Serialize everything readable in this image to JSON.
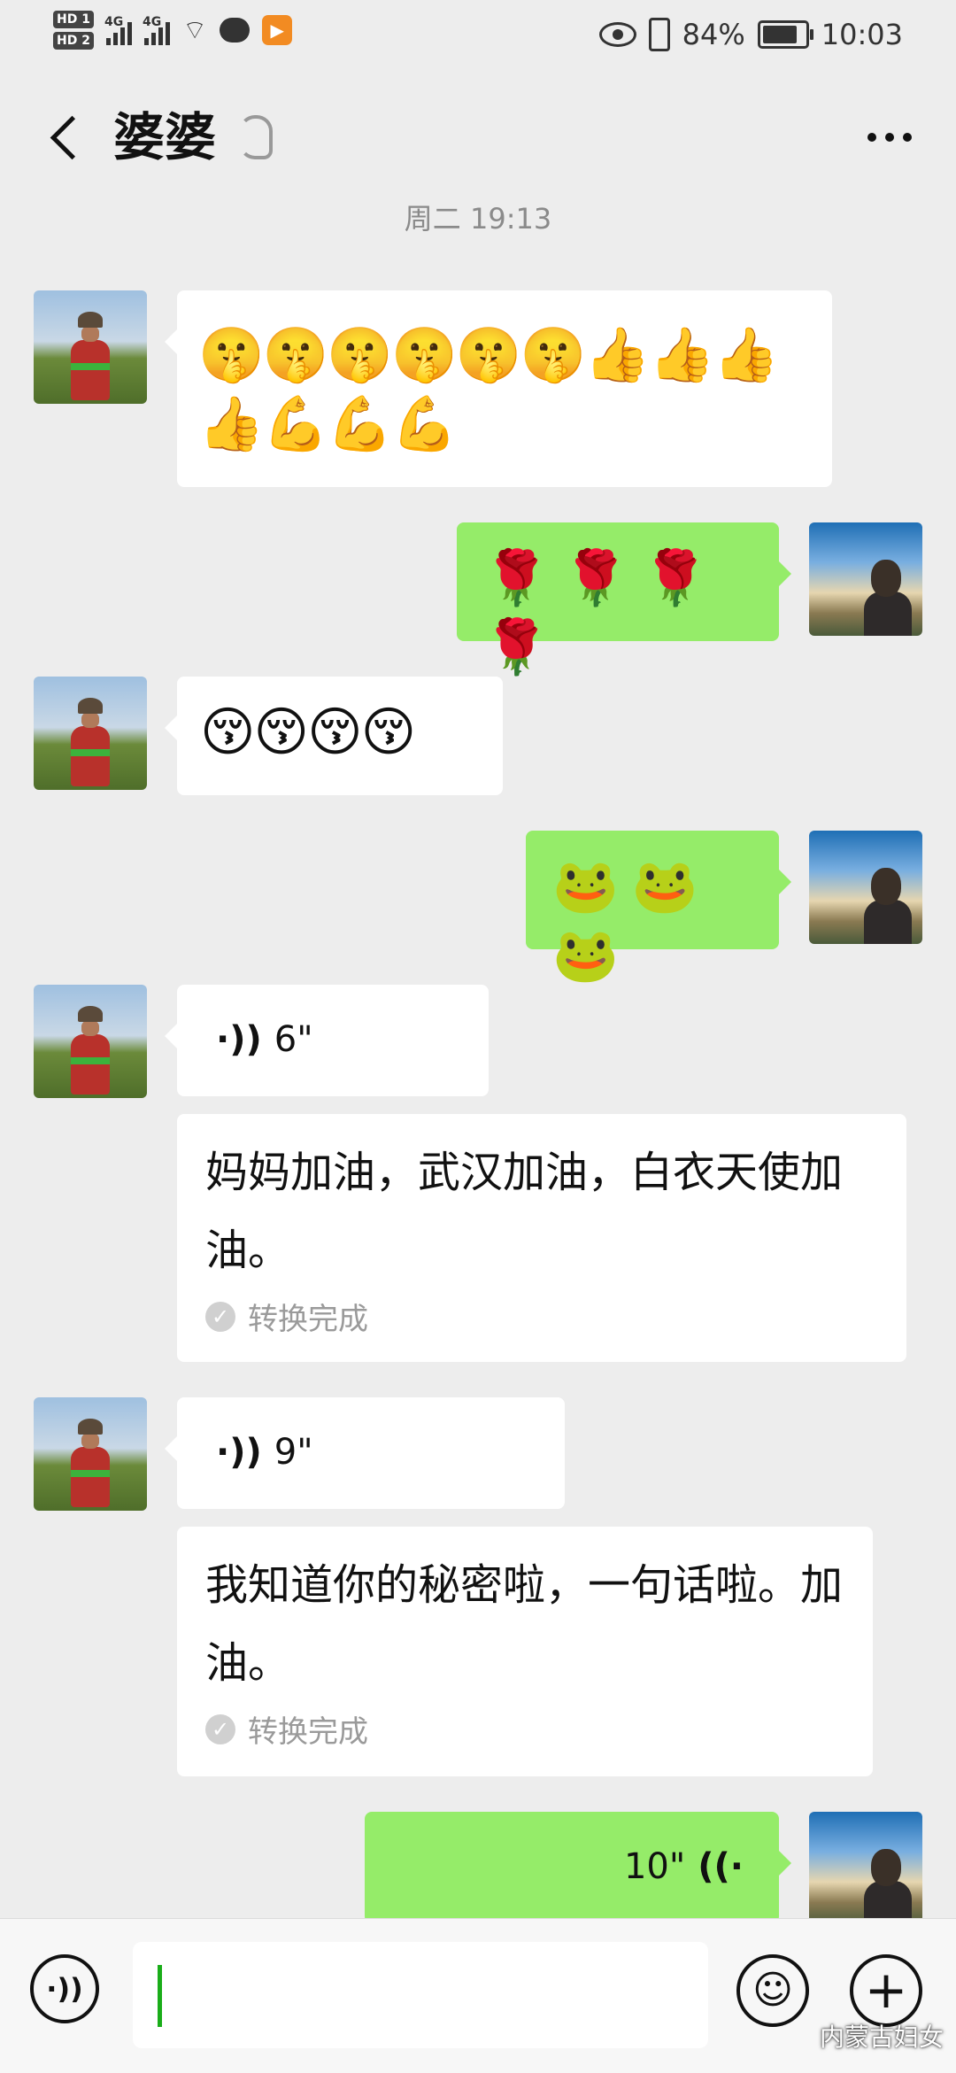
{
  "status_bar": {
    "hd1": "HD 1",
    "hd2": "HD 2",
    "net1": "4G",
    "net2": "4G",
    "app_badge": "▶",
    "battery_percent": "84%",
    "battery_level": 0.84,
    "time": "10:03"
  },
  "header": {
    "back_glyph": "<",
    "contact_name": "婆婆",
    "more_glyph": "..."
  },
  "timestamp": "周二 19:13",
  "messages": [
    {
      "from": "contact",
      "type": "emoji",
      "line1": "🤫🤫🤫🤫🤫🤫👍👍👍",
      "line2": "👍💪💪💪"
    },
    {
      "from": "me",
      "type": "emoji",
      "line1": "🌹 🌹 🌹 🌹"
    },
    {
      "from": "contact",
      "type": "emoji",
      "line1": "😚😚😚😚"
    },
    {
      "from": "me",
      "type": "emoji",
      "line1": "🐸 🐸 🐸"
    },
    {
      "from": "contact",
      "type": "voice",
      "duration": "6\"",
      "transcript": "妈妈加油，武汉加油，白衣天使加油。",
      "status": "转换完成"
    },
    {
      "from": "contact",
      "type": "voice",
      "duration": "9\"",
      "transcript": "我知道你的秘密啦，一句话啦。加油。",
      "status": "转换完成"
    },
    {
      "from": "me",
      "type": "voice",
      "duration": "10\""
    }
  ],
  "input_bar": {
    "voice_icon": "voice-toggle-icon",
    "emoji_icon": "emoji-icon",
    "plus_icon": "plus-icon"
  },
  "watermark": "内蒙古妇女",
  "colors": {
    "background": "#ededed",
    "incoming_bubble": "#ffffff",
    "outgoing_bubble": "#95ec69",
    "caret": "#1aad19"
  }
}
